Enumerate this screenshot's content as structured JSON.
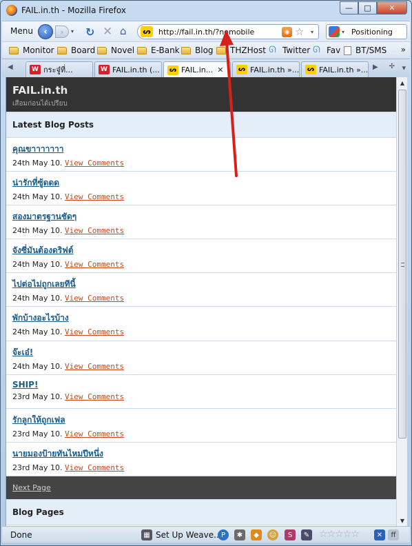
{
  "window": {
    "title": "FAIL.in.th - Mozilla Firefox",
    "minimize": "—",
    "maximize": "□",
    "close": "✕"
  },
  "navbar": {
    "menu_label": "Menu",
    "back": "‹",
    "forward": "›",
    "dropdown": "▾",
    "reload": "↻",
    "stop": "✕",
    "home": "⌂",
    "url": "http://fail.in.th/?nomobile",
    "site_icon": "ᔕ",
    "rss": "◉",
    "star": "☆",
    "search_engine": "Google",
    "search_value": "Positioning"
  },
  "bookmarks": {
    "items": [
      {
        "label": "Monitor",
        "icon": "folder-icon"
      },
      {
        "label": "Board",
        "icon": "folder-icon"
      },
      {
        "label": "Novel",
        "icon": "folder-icon"
      },
      {
        "label": "E-Bank",
        "icon": "folder-icon"
      },
      {
        "label": "Blog",
        "icon": "folder-icon"
      },
      {
        "label": "THZHost",
        "icon": "folder-icon"
      },
      {
        "label": "Twitter",
        "icon": "twitter-icon"
      },
      {
        "label": "Fav",
        "icon": "twitter-icon"
      },
      {
        "label": "BT/SMS",
        "icon": "page-icon"
      }
    ],
    "more": "»"
  },
  "tabs": {
    "scroll_left": "◀",
    "items": [
      {
        "label": "กระจู๋ที่...",
        "icon": "w",
        "active": false
      },
      {
        "label": "FAIL.in.th (...",
        "icon": "w",
        "active": false
      },
      {
        "label": "FAIL.in...",
        "icon": "y",
        "active": true
      },
      {
        "label": "FAIL.in.th »...",
        "icon": "y",
        "active": false
      },
      {
        "label": "FAIL.in.th »...",
        "icon": "y",
        "active": false
      }
    ],
    "close": "✕",
    "scroll_right": "▶",
    "list": "▾",
    "new_tab": "✢"
  },
  "site": {
    "title": "FAIL.in.th",
    "tagline": "เสือมก่อนได้เปรียบ",
    "latest_heading": "Latest Blog Posts",
    "posts": [
      {
        "title": "คุณขาาาาาาา",
        "date": "24th May 10.",
        "link": "View Comments"
      },
      {
        "title": "น่ารักที่ซู้ดดด",
        "date": "24th May 10.",
        "link": "View Comments"
      },
      {
        "title": "สองมาตรฐานชัดๆ",
        "date": "24th May 10.",
        "link": "View Comments"
      },
      {
        "title": "จังซี่มันต้องดริฟต์",
        "date": "24th May 10.",
        "link": "View Comments"
      },
      {
        "title": "ไปต่อไม่ถูกเลยทีนี้",
        "date": "24th May 10.",
        "link": "View Comments"
      },
      {
        "title": "พักบ้างอะไรบ้าง",
        "date": "24th May 10.",
        "link": "View Comments"
      },
      {
        "title": "จ๊ะเอ๋!",
        "date": "24th May 10.",
        "link": "View Comments"
      },
      {
        "title": "SHIP!",
        "date": "23rd May 10.",
        "link": "View Comments"
      },
      {
        "title": "รักลูกให้ถูกเฟล",
        "date": "23rd May 10.",
        "link": "View Comments"
      },
      {
        "title": "นายมองป้ายทันไหมปีหนึ่ง",
        "date": "23rd May 10.",
        "link": "View Comments"
      }
    ],
    "next_page": "Next Page",
    "pages_heading": "Blog Pages"
  },
  "scrollbar": {
    "up": "▲",
    "down": "▼"
  },
  "status": {
    "text": "Done",
    "setup": "Set Up Weave...",
    "stars": "☆☆☆☆☆",
    "colors": {
      "arrow": "#d8201a"
    }
  }
}
